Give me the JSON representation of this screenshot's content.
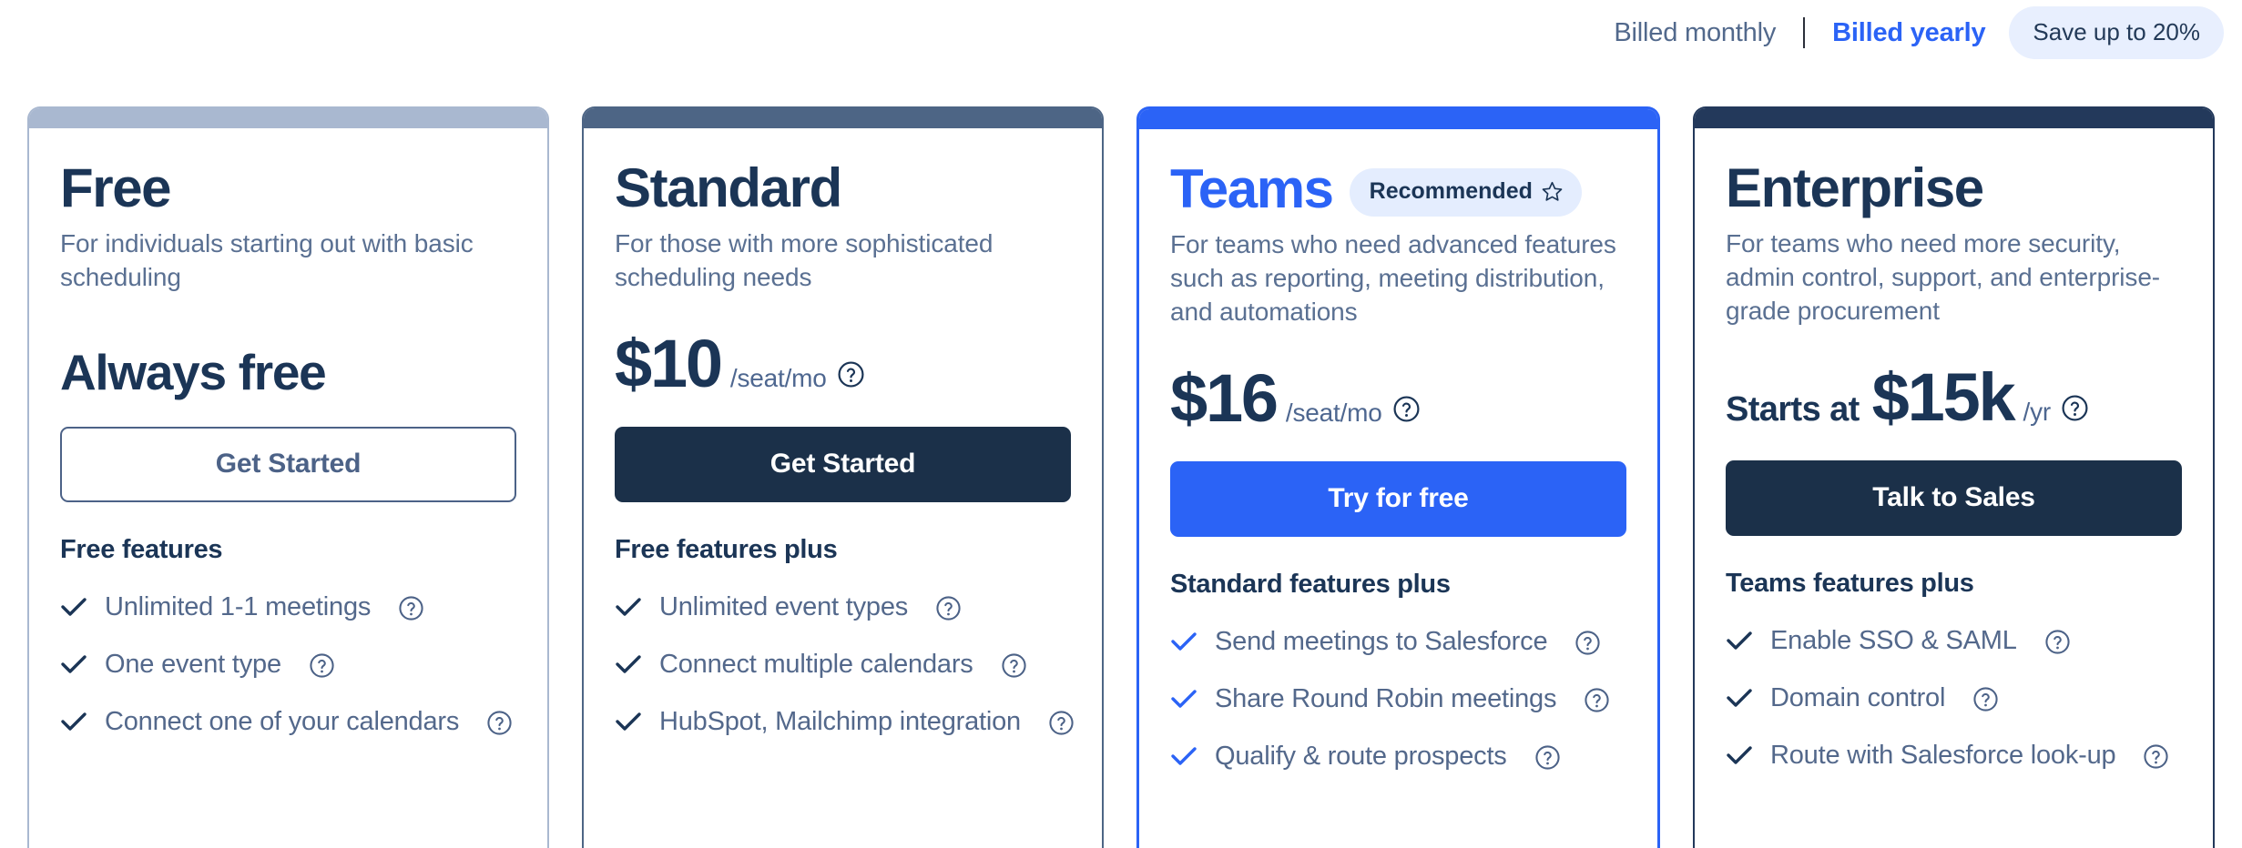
{
  "billing": {
    "monthly_label": "Billed monthly",
    "separator": "|",
    "yearly_label": "Billed yearly",
    "save_badge": "Save up to 20%",
    "active": "yearly"
  },
  "colors": {
    "brand_blue": "#2B63F6",
    "navy": "#1B3556",
    "slate": "#53688B",
    "free_bar": "#A9B8D0",
    "standard_bar": "#4D6585",
    "enterprise_bar": "#23395B",
    "badge_bg": "#E4EDFE"
  },
  "plans": [
    {
      "key": "free",
      "name": "Free",
      "description": "For individuals starting out with basic scheduling",
      "price_prefix": "",
      "price_amount": "",
      "price_unit": "",
      "price_free_label": "Always free",
      "has_help_icon": false,
      "cta_label": "Get Started",
      "cta_style": "outline",
      "recommended_badge": "",
      "features_title": "Free features",
      "features": [
        "Unlimited 1-1 meetings",
        "One event type",
        "Connect one of your calendars"
      ]
    },
    {
      "key": "standard",
      "name": "Standard",
      "description": "For those with more sophisticated scheduling needs",
      "price_prefix": "",
      "price_amount": "$10",
      "price_unit": "/seat/mo",
      "price_free_label": "",
      "has_help_icon": true,
      "cta_label": "Get Started",
      "cta_style": "dark",
      "recommended_badge": "",
      "features_title": "Free features plus",
      "features": [
        "Unlimited event types",
        "Connect multiple calendars",
        "HubSpot, Mailchimp integration"
      ]
    },
    {
      "key": "teams",
      "name": "Teams",
      "description": "For teams who need advanced features such as reporting, meeting distribution, and automations",
      "price_prefix": "",
      "price_amount": "$16",
      "price_unit": "/seat/mo",
      "price_free_label": "",
      "has_help_icon": true,
      "cta_label": "Try for free",
      "cta_style": "blue",
      "recommended_badge": "Recommended",
      "features_title": "Standard features plus",
      "features": [
        "Send meetings to Salesforce",
        "Share Round Robin meetings",
        "Qualify & route prospects"
      ]
    },
    {
      "key": "enterprise",
      "name": "Enterprise",
      "description": "For teams who need more security, admin control, support, and enterprise-grade procurement",
      "price_prefix": "Starts at",
      "price_amount": "$15k",
      "price_unit": "/yr",
      "price_free_label": "",
      "has_help_icon": true,
      "cta_label": "Talk to Sales",
      "cta_style": "dark",
      "recommended_badge": "",
      "features_title": "Teams features plus",
      "features": [
        "Enable SSO & SAML",
        "Domain control",
        "Route with Salesforce look-up"
      ]
    }
  ]
}
